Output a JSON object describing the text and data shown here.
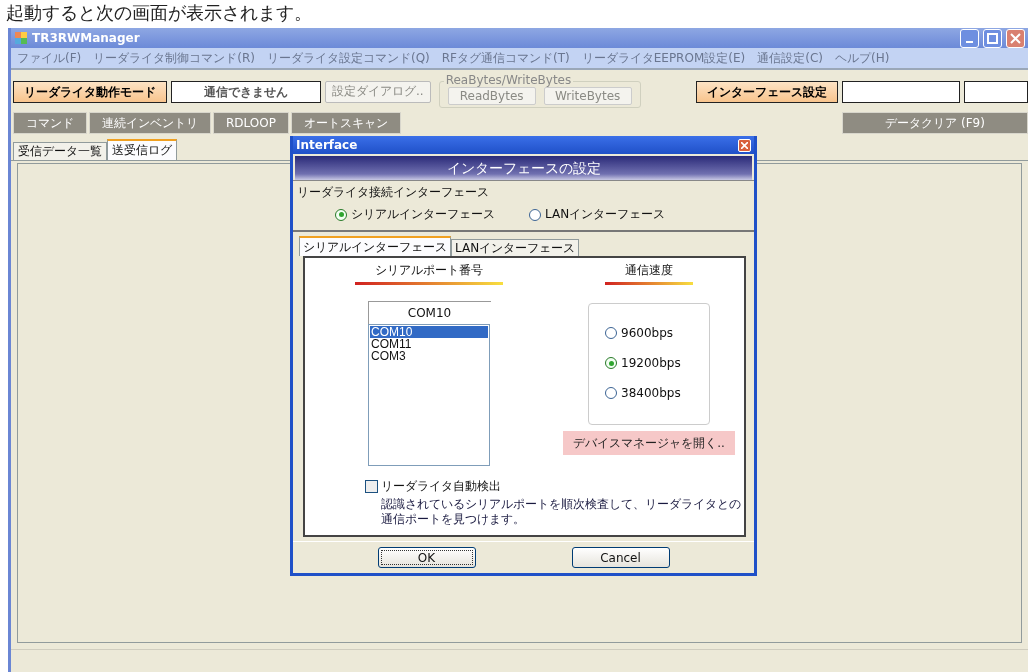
{
  "caption": "起動すると次の画面が表示されます。",
  "window": {
    "title": "TR3RWManager"
  },
  "menu": [
    {
      "label": "ファイル(F)",
      "disabled": true
    },
    {
      "label": "リーダライタ制御コマンド(R)",
      "disabled": true
    },
    {
      "label": "リーダライタ設定コマンド(Q)",
      "disabled": true
    },
    {
      "label": "RFタグ通信コマンド(T)",
      "disabled": true
    },
    {
      "label": "リーダライタEEPROM設定(E)",
      "disabled": true
    },
    {
      "label": "通信設定(C)",
      "disabled": true
    },
    {
      "label": "ヘルプ(H)",
      "disabled": true
    }
  ],
  "toolbar": {
    "mode_label": "リーダライタ動作モード",
    "status": "通信できません",
    "settings_button": {
      "label": "設定ダイアログ..",
      "disabled": true
    },
    "bytes_group": {
      "title": "ReaBytes/WriteBytes",
      "buttons": [
        {
          "label": "ReadBytes",
          "disabled": true
        },
        {
          "label": "WriteBytes",
          "disabled": true
        }
      ]
    },
    "interface_label": "インターフェース設定",
    "command_buttons": [
      {
        "label": "コマンド",
        "disabled": true
      },
      {
        "label": "連続インベントリ",
        "disabled": true
      },
      {
        "label": "RDLOOP",
        "disabled": true
      },
      {
        "label": "オートスキャン",
        "disabled": true
      }
    ],
    "clear_button": {
      "label": "データクリア (F9)",
      "disabled": true
    }
  },
  "tabs": [
    {
      "label": "受信データ一覧",
      "selected": false
    },
    {
      "label": "送受信ログ",
      "selected": true
    }
  ],
  "dialog": {
    "title": "Interface",
    "header": "インターフェースの設定",
    "group_label": "リーダライタ接続インターフェース",
    "interface_options": [
      {
        "label": "シリアルインターフェース",
        "selected": true
      },
      {
        "label": "LANインターフェース",
        "selected": false
      }
    ],
    "tabs": [
      {
        "label": "シリアルインターフェース",
        "selected": true
      },
      {
        "label": "LANインターフェース",
        "selected": false
      }
    ],
    "port_heading": "シリアルポート番号",
    "port_value": "COM10",
    "ports": [
      {
        "label": "COM10",
        "selected": true
      },
      {
        "label": "COM11",
        "selected": false
      },
      {
        "label": "COM3",
        "selected": false
      }
    ],
    "speed_heading": "通信速度",
    "speeds": [
      {
        "label": "9600bps",
        "selected": false
      },
      {
        "label": "19200bps",
        "selected": true
      },
      {
        "label": "38400bps",
        "selected": false
      }
    ],
    "device_manager_button": "デバイスマネージャを開く..",
    "auto_detect": {
      "label": "リーダライタ自動検出",
      "checked": false
    },
    "auto_detect_note": "認識されているシリアルポートを順次検査して、リーダライタとの通信ポートを見つけます。",
    "buttons": [
      "OK",
      "Cancel"
    ]
  }
}
